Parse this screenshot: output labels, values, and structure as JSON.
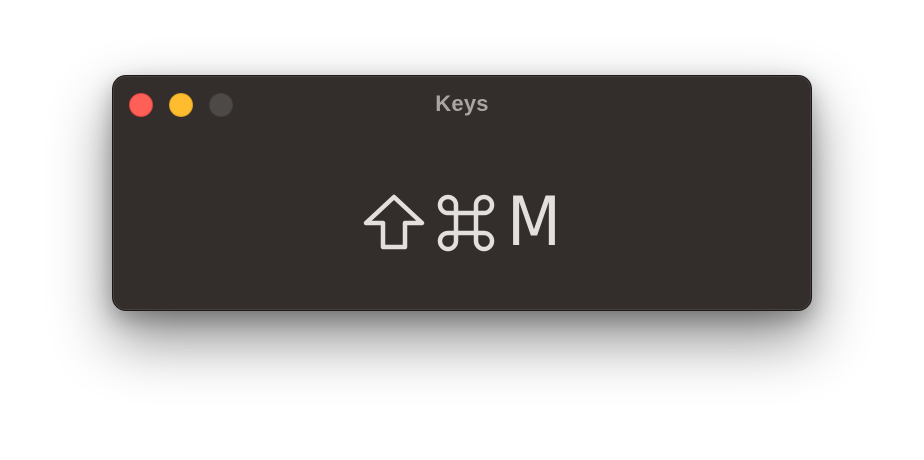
{
  "window": {
    "title": "Keys",
    "traffic_lights": {
      "close": "#fe5f57",
      "minimize": "#febc2e",
      "zoom": "#4d4947"
    }
  },
  "keys": {
    "modifiers": [
      {
        "name": "shift",
        "icon": "shift-icon",
        "symbol": "⇧"
      },
      {
        "name": "command",
        "icon": "command-icon",
        "symbol": "⌘"
      }
    ],
    "letter": "M"
  },
  "colors": {
    "window_background": "#332e2c",
    "title_text": "#a9a5a2",
    "key_text": "#e2dfdc"
  }
}
